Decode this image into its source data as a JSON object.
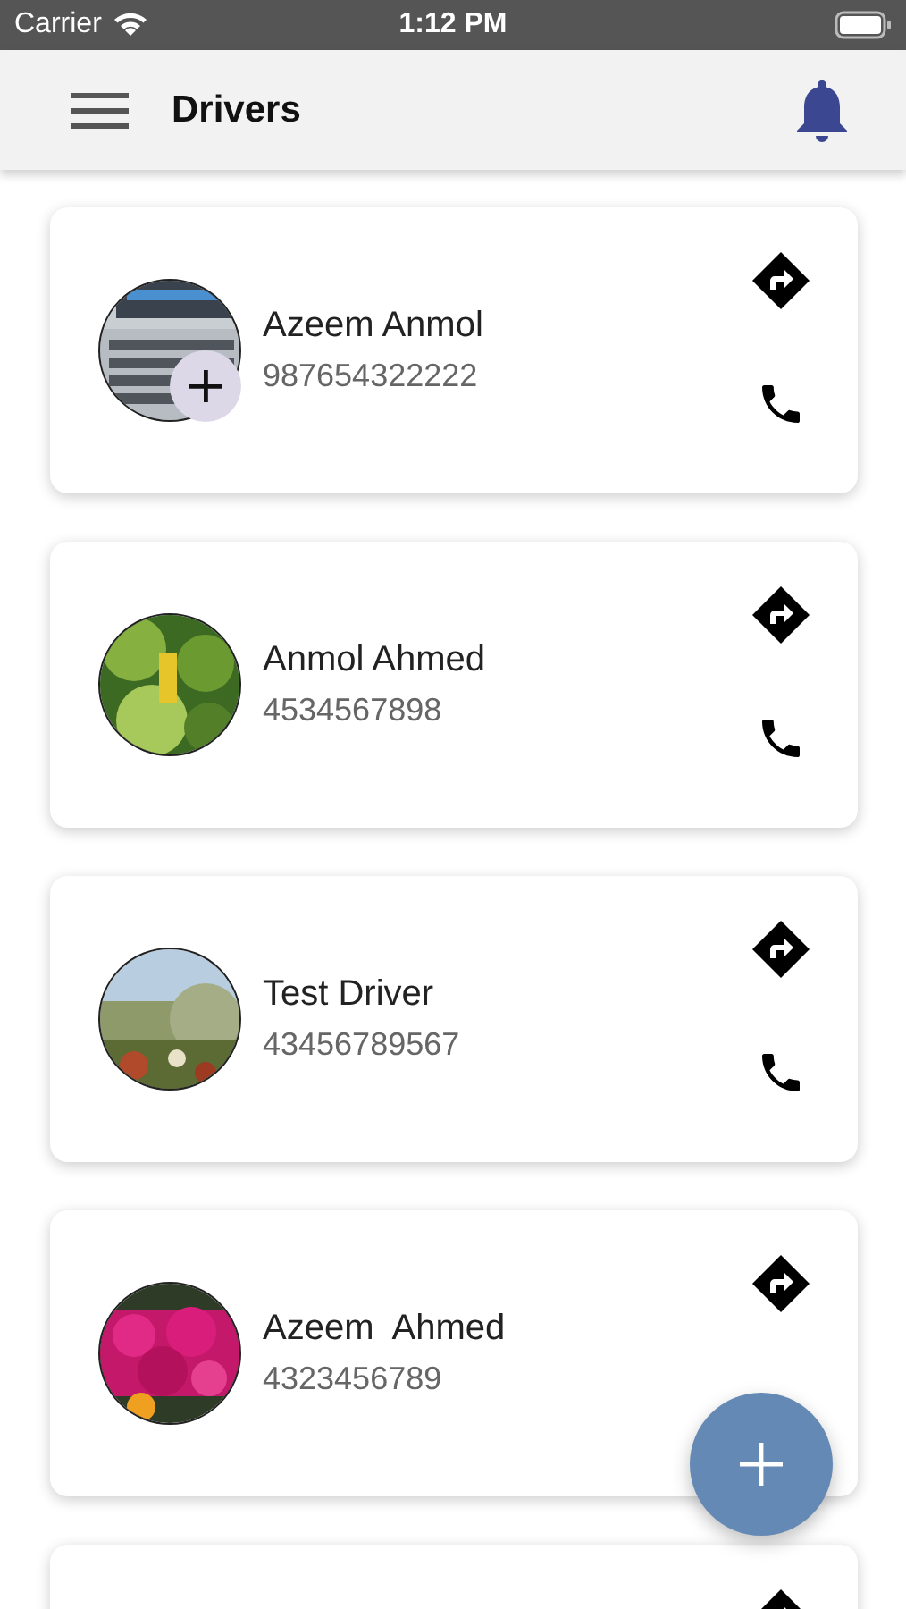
{
  "status_bar": {
    "carrier": "Carrier",
    "time": "1:12 PM"
  },
  "header": {
    "title": "Drivers"
  },
  "drivers": [
    {
      "name": "Azeem Anmol",
      "phone": "987654322222",
      "photo": {
        "kind": "picture"
      },
      "add_badge": true,
      "actions": [
        {
          "kind": "directions"
        },
        {
          "kind": "call"
        }
      ]
    },
    {
      "name": "Anmol Ahmed",
      "phone": "4534567898",
      "photo": {
        "kind": "picture"
      },
      "add_badge": false,
      "actions": [
        {
          "kind": "directions"
        },
        {
          "kind": "call"
        }
      ]
    },
    {
      "name": "Test Driver",
      "phone": "43456789567",
      "photo": {
        "kind": "picture"
      },
      "add_badge": false,
      "actions": [
        {
          "kind": "directions"
        },
        {
          "kind": "call"
        }
      ]
    },
    {
      "name": "Azeem  Ahmed",
      "phone": "4323456789",
      "photo": {
        "kind": "picture"
      },
      "add_badge": false,
      "actions": [
        {
          "kind": "directions"
        }
      ]
    },
    {
      "actions": [
        {
          "kind": "directions"
        }
      ]
    }
  ],
  "fab": {
    "kind": "add"
  }
}
